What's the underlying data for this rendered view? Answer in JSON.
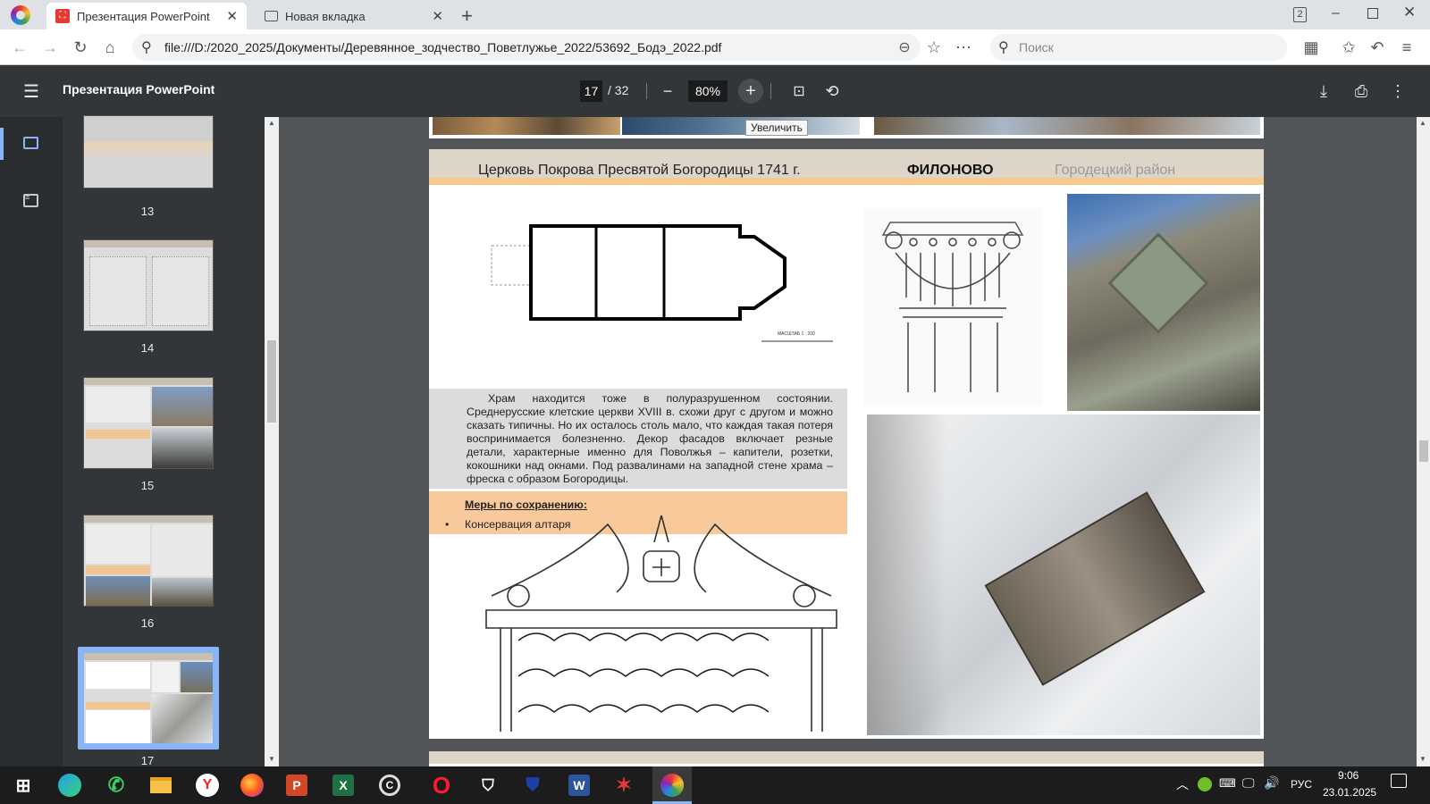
{
  "tabs": [
    {
      "title": "Презентация PowerPoint",
      "active": true
    },
    {
      "title": "Новая вкладка",
      "active": false
    }
  ],
  "window": {
    "tab_count_badge": "2"
  },
  "address": {
    "url": "file:///D:/2020_2025/Документы/Деревянное_зодчество_Поветлужье_2022/53692_Бодэ_2022.pdf",
    "search_placeholder": "Поиск"
  },
  "pdf_toolbar": {
    "title": "Презентация PowerPoint",
    "page_current": "17",
    "page_total": "/ 32",
    "zoom": "80%",
    "zoom_tooltip": "Увеличить"
  },
  "sidebar": {
    "thumbnails": [
      {
        "number": "13"
      },
      {
        "number": "14"
      },
      {
        "number": "15"
      },
      {
        "number": "16"
      },
      {
        "number": "17",
        "selected": true
      }
    ]
  },
  "slide": {
    "header_title": "Церковь Покрова Пресвятой Богородицы   1741 г.",
    "header_village": "ФИЛОНОВО",
    "header_district": "Городецкий район",
    "scale_label": "МАСШТАБ 1 : 200",
    "description": "Храм находится тоже в полуразрушенном состоянии. Среднерусские клетские церкви XVIII в. схожи друг с другом и можно сказать типичны. Но их осталось столь мало, что каждая такая потеря воспринимается болезненно. Декор фасадов включает резные детали, характерные именно для Поволжья – капители, розетки, кокошники над окнами. Под развалинами на западной стене храма – фреска с образом Богородицы.",
    "measures_title": "Меры по сохранению:",
    "measures_items": [
      "Консервация алтаря"
    ]
  },
  "taskbar": {
    "lang": "РУС",
    "time": "9:06",
    "date": "23.01.2025"
  },
  "colors": {
    "pdf_toolbar": "#323639",
    "viewer_bg": "#525659",
    "header_band": "#ddd5c8",
    "header_accent": "#f7c98d",
    "measures_bg": "#f8c99a",
    "selection": "#8ab4f8"
  }
}
